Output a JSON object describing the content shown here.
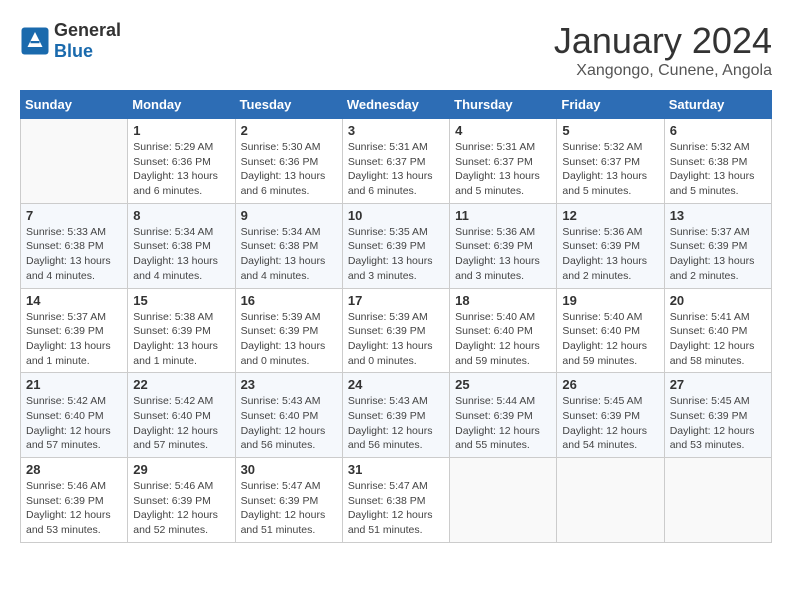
{
  "header": {
    "logo_line1": "General",
    "logo_line2": "Blue",
    "month": "January 2024",
    "location": "Xangongo, Cunene, Angola"
  },
  "weekdays": [
    "Sunday",
    "Monday",
    "Tuesday",
    "Wednesday",
    "Thursday",
    "Friday",
    "Saturday"
  ],
  "weeks": [
    [
      {
        "day": "",
        "sunrise": "",
        "sunset": "",
        "daylight": ""
      },
      {
        "day": "1",
        "sunrise": "Sunrise: 5:29 AM",
        "sunset": "Sunset: 6:36 PM",
        "daylight": "Daylight: 13 hours and 6 minutes."
      },
      {
        "day": "2",
        "sunrise": "Sunrise: 5:30 AM",
        "sunset": "Sunset: 6:36 PM",
        "daylight": "Daylight: 13 hours and 6 minutes."
      },
      {
        "day": "3",
        "sunrise": "Sunrise: 5:31 AM",
        "sunset": "Sunset: 6:37 PM",
        "daylight": "Daylight: 13 hours and 6 minutes."
      },
      {
        "day": "4",
        "sunrise": "Sunrise: 5:31 AM",
        "sunset": "Sunset: 6:37 PM",
        "daylight": "Daylight: 13 hours and 5 minutes."
      },
      {
        "day": "5",
        "sunrise": "Sunrise: 5:32 AM",
        "sunset": "Sunset: 6:37 PM",
        "daylight": "Daylight: 13 hours and 5 minutes."
      },
      {
        "day": "6",
        "sunrise": "Sunrise: 5:32 AM",
        "sunset": "Sunset: 6:38 PM",
        "daylight": "Daylight: 13 hours and 5 minutes."
      }
    ],
    [
      {
        "day": "7",
        "sunrise": "Sunrise: 5:33 AM",
        "sunset": "Sunset: 6:38 PM",
        "daylight": "Daylight: 13 hours and 4 minutes."
      },
      {
        "day": "8",
        "sunrise": "Sunrise: 5:34 AM",
        "sunset": "Sunset: 6:38 PM",
        "daylight": "Daylight: 13 hours and 4 minutes."
      },
      {
        "day": "9",
        "sunrise": "Sunrise: 5:34 AM",
        "sunset": "Sunset: 6:38 PM",
        "daylight": "Daylight: 13 hours and 4 minutes."
      },
      {
        "day": "10",
        "sunrise": "Sunrise: 5:35 AM",
        "sunset": "Sunset: 6:39 PM",
        "daylight": "Daylight: 13 hours and 3 minutes."
      },
      {
        "day": "11",
        "sunrise": "Sunrise: 5:36 AM",
        "sunset": "Sunset: 6:39 PM",
        "daylight": "Daylight: 13 hours and 3 minutes."
      },
      {
        "day": "12",
        "sunrise": "Sunrise: 5:36 AM",
        "sunset": "Sunset: 6:39 PM",
        "daylight": "Daylight: 13 hours and 2 minutes."
      },
      {
        "day": "13",
        "sunrise": "Sunrise: 5:37 AM",
        "sunset": "Sunset: 6:39 PM",
        "daylight": "Daylight: 13 hours and 2 minutes."
      }
    ],
    [
      {
        "day": "14",
        "sunrise": "Sunrise: 5:37 AM",
        "sunset": "Sunset: 6:39 PM",
        "daylight": "Daylight: 13 hours and 1 minute."
      },
      {
        "day": "15",
        "sunrise": "Sunrise: 5:38 AM",
        "sunset": "Sunset: 6:39 PM",
        "daylight": "Daylight: 13 hours and 1 minute."
      },
      {
        "day": "16",
        "sunrise": "Sunrise: 5:39 AM",
        "sunset": "Sunset: 6:39 PM",
        "daylight": "Daylight: 13 hours and 0 minutes."
      },
      {
        "day": "17",
        "sunrise": "Sunrise: 5:39 AM",
        "sunset": "Sunset: 6:39 PM",
        "daylight": "Daylight: 13 hours and 0 minutes."
      },
      {
        "day": "18",
        "sunrise": "Sunrise: 5:40 AM",
        "sunset": "Sunset: 6:40 PM",
        "daylight": "Daylight: 12 hours and 59 minutes."
      },
      {
        "day": "19",
        "sunrise": "Sunrise: 5:40 AM",
        "sunset": "Sunset: 6:40 PM",
        "daylight": "Daylight: 12 hours and 59 minutes."
      },
      {
        "day": "20",
        "sunrise": "Sunrise: 5:41 AM",
        "sunset": "Sunset: 6:40 PM",
        "daylight": "Daylight: 12 hours and 58 minutes."
      }
    ],
    [
      {
        "day": "21",
        "sunrise": "Sunrise: 5:42 AM",
        "sunset": "Sunset: 6:40 PM",
        "daylight": "Daylight: 12 hours and 57 minutes."
      },
      {
        "day": "22",
        "sunrise": "Sunrise: 5:42 AM",
        "sunset": "Sunset: 6:40 PM",
        "daylight": "Daylight: 12 hours and 57 minutes."
      },
      {
        "day": "23",
        "sunrise": "Sunrise: 5:43 AM",
        "sunset": "Sunset: 6:40 PM",
        "daylight": "Daylight: 12 hours and 56 minutes."
      },
      {
        "day": "24",
        "sunrise": "Sunrise: 5:43 AM",
        "sunset": "Sunset: 6:39 PM",
        "daylight": "Daylight: 12 hours and 56 minutes."
      },
      {
        "day": "25",
        "sunrise": "Sunrise: 5:44 AM",
        "sunset": "Sunset: 6:39 PM",
        "daylight": "Daylight: 12 hours and 55 minutes."
      },
      {
        "day": "26",
        "sunrise": "Sunrise: 5:45 AM",
        "sunset": "Sunset: 6:39 PM",
        "daylight": "Daylight: 12 hours and 54 minutes."
      },
      {
        "day": "27",
        "sunrise": "Sunrise: 5:45 AM",
        "sunset": "Sunset: 6:39 PM",
        "daylight": "Daylight: 12 hours and 53 minutes."
      }
    ],
    [
      {
        "day": "28",
        "sunrise": "Sunrise: 5:46 AM",
        "sunset": "Sunset: 6:39 PM",
        "daylight": "Daylight: 12 hours and 53 minutes."
      },
      {
        "day": "29",
        "sunrise": "Sunrise: 5:46 AM",
        "sunset": "Sunset: 6:39 PM",
        "daylight": "Daylight: 12 hours and 52 minutes."
      },
      {
        "day": "30",
        "sunrise": "Sunrise: 5:47 AM",
        "sunset": "Sunset: 6:39 PM",
        "daylight": "Daylight: 12 hours and 51 minutes."
      },
      {
        "day": "31",
        "sunrise": "Sunrise: 5:47 AM",
        "sunset": "Sunset: 6:38 PM",
        "daylight": "Daylight: 12 hours and 51 minutes."
      },
      {
        "day": "",
        "sunrise": "",
        "sunset": "",
        "daylight": ""
      },
      {
        "day": "",
        "sunrise": "",
        "sunset": "",
        "daylight": ""
      },
      {
        "day": "",
        "sunrise": "",
        "sunset": "",
        "daylight": ""
      }
    ]
  ]
}
